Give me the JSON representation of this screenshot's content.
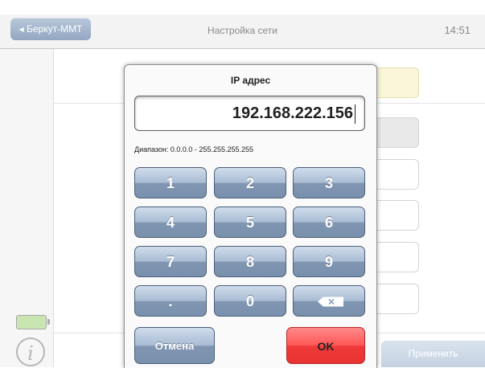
{
  "header": {
    "back_label": "◂ Беркут-ММТ",
    "title": "Настройка сети",
    "time": "14:51"
  },
  "footer": {
    "apply_label": "Применить"
  },
  "dialog": {
    "title": "IP адрес",
    "ip_value": "192.168.222.156",
    "range_text": "Диапазон: 0.0.0.0 - 255.255.255.255",
    "keys": [
      "1",
      "2",
      "3",
      "4",
      "5",
      "6",
      "7",
      "8",
      "9",
      ".",
      "0"
    ],
    "backspace_icon": "backspace-icon",
    "cancel_label": "Отмена",
    "ok_label": "OK"
  },
  "colors": {
    "ok_button": "#ff5656",
    "key_button": "#8096b2",
    "battery_fill": "#c9e6b2"
  }
}
